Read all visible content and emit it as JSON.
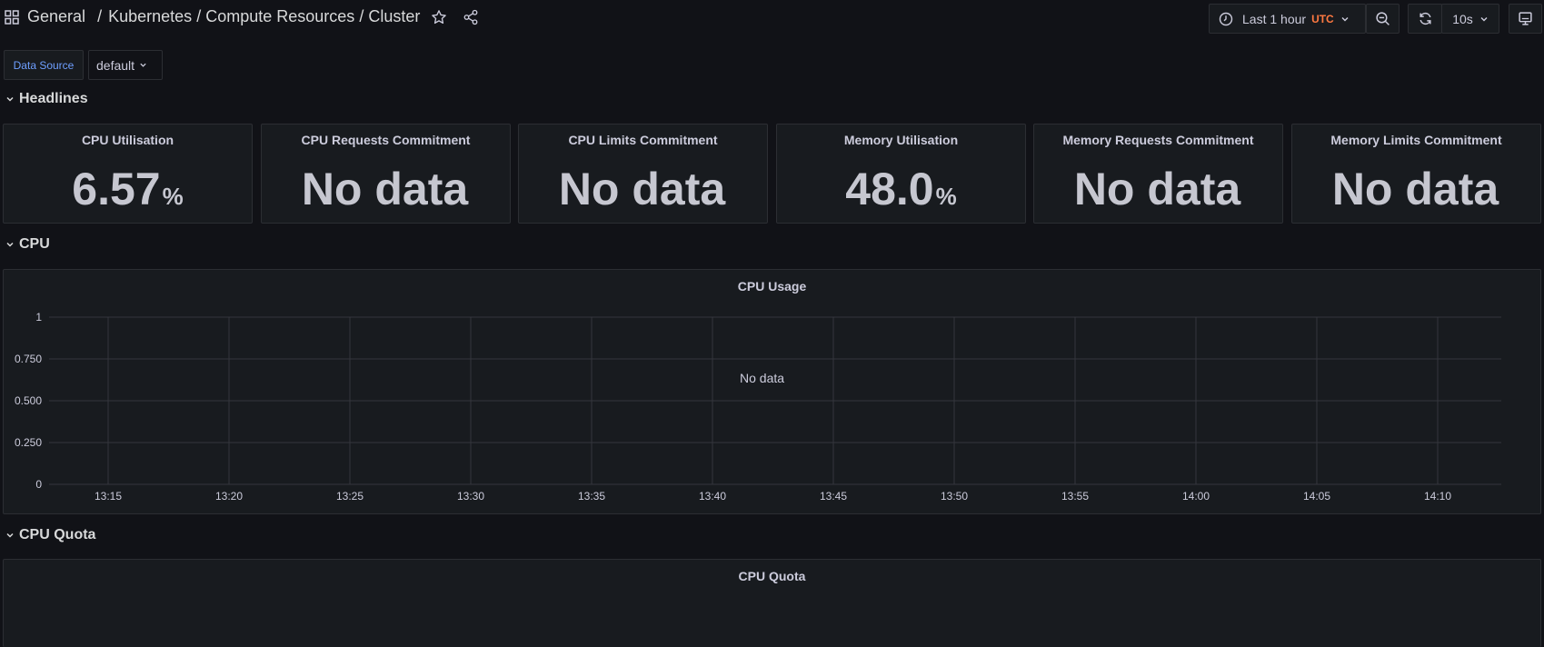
{
  "header": {
    "breadcrumb": [
      "General",
      "Kubernetes",
      "Compute Resources",
      "Cluster"
    ],
    "separator": "/",
    "time_range": "Last 1 hour",
    "timezone": "UTC",
    "refresh_interval": "10s",
    "icons": [
      "apps-icon",
      "star-icon",
      "share-icon",
      "clock-icon",
      "zoom-out-icon",
      "refresh-icon",
      "tv-monitor-icon"
    ]
  },
  "variables": {
    "label": "Data Source",
    "value": "default"
  },
  "rows": {
    "headlines": "Headlines",
    "cpu": "CPU",
    "cpu_quota": "CPU Quota"
  },
  "stats": [
    {
      "title": "CPU Utilisation",
      "value": "6.57",
      "unit": "%"
    },
    {
      "title": "CPU Requests Commitment",
      "value": "No data",
      "unit": ""
    },
    {
      "title": "CPU Limits Commitment",
      "value": "No data",
      "unit": ""
    },
    {
      "title": "Memory Utilisation",
      "value": "48.0",
      "unit": "%"
    },
    {
      "title": "Memory Requests Commitment",
      "value": "No data",
      "unit": ""
    },
    {
      "title": "Memory Limits Commitment",
      "value": "No data",
      "unit": ""
    }
  ],
  "cpu_usage_panel": {
    "title": "CPU Usage",
    "message": "No data"
  },
  "cpu_quota_panel": {
    "title": "CPU Quota"
  },
  "chart_data": {
    "type": "line",
    "title": "CPU Usage",
    "series": [],
    "y_ticks": [
      "0",
      "0.250",
      "0.500",
      "0.750",
      "1"
    ],
    "ylim": [
      0,
      1
    ],
    "x_ticks": [
      "13:15",
      "13:20",
      "13:25",
      "13:30",
      "13:35",
      "13:40",
      "13:45",
      "13:50",
      "13:55",
      "14:00",
      "14:05",
      "14:10"
    ],
    "grid": true,
    "legend": "none"
  }
}
